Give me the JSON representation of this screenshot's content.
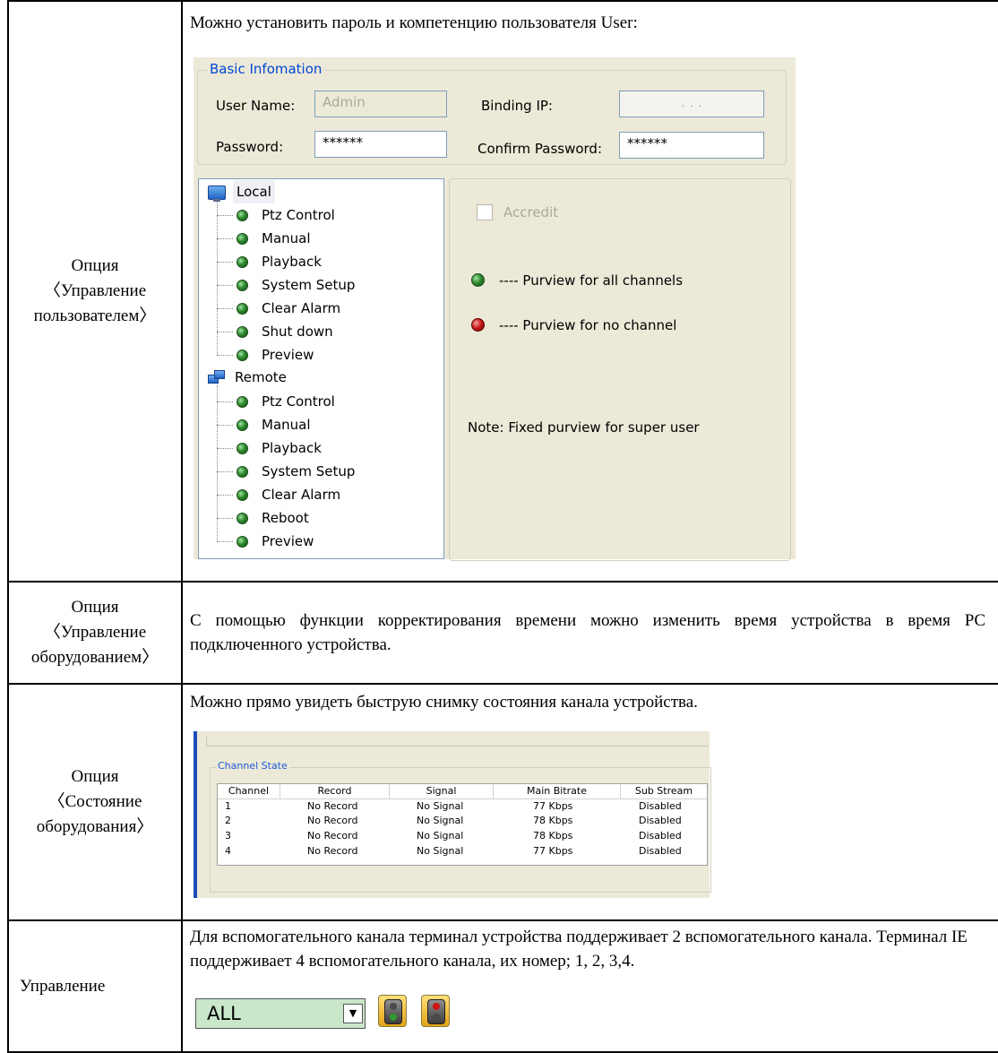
{
  "rows": [
    {
      "left": [
        "Опция",
        "〈Управление",
        "пользователем〉"
      ],
      "right_text": "Можно установить пароль и компетенцию пользователя User:"
    },
    {
      "left": [
        "Опция",
        "〈Управление",
        "оборудованием〉"
      ],
      "right_text": "С помощью функции корректирования времени можно изменить время устройства в время PC подключенного устройства."
    },
    {
      "left": [
        "Опция",
        "〈Состояние",
        "оборудования〉"
      ],
      "right_text": "Можно прямо увидеть быструю снимку состояния канала устройства."
    },
    {
      "left": [
        "Управление"
      ],
      "right_text": "Для вспомогательного канала терминал устройства поддерживает 2 вспомогательного канала. Терминал IE поддерживает 4 вспомогательного канала, их номер; 1, 2, 3,4."
    }
  ],
  "user_dialog": {
    "group_title": "Basic Infomation",
    "user_name_label": "User Name:",
    "user_name_value": "Admin",
    "binding_ip_label": "Binding IP:",
    "binding_ip_value": ".   .   .",
    "password_label": "Password:",
    "password_value": "******",
    "confirm_password_label": "Confirm Password:",
    "confirm_password_value": "******",
    "tree": {
      "local_label": "Local",
      "local_items": [
        "Ptz Control",
        "Manual",
        "Playback",
        "System Setup",
        "Clear Alarm",
        "Shut down",
        "Preview"
      ],
      "remote_label": "Remote",
      "remote_items": [
        "Ptz Control",
        "Manual",
        "Playback",
        "System Setup",
        "Clear Alarm",
        "Reboot",
        "Preview"
      ]
    },
    "accredit_label": "Accredit",
    "legend_all": "----  Purview for all channels",
    "legend_none": "----  Purview for no channel",
    "note": "Note: Fixed purview for super user"
  },
  "channel_state": {
    "group_title": "Channel State",
    "columns": [
      "Channel",
      "Record",
      "Signal",
      "Main Bitrate",
      "Sub Stream"
    ],
    "rows": [
      [
        "1",
        "No Record",
        "No Signal",
        "77 Kbps",
        "Disabled"
      ],
      [
        "2",
        "No Record",
        "No Signal",
        "78 Kbps",
        "Disabled"
      ],
      [
        "3",
        "No Record",
        "No Signal",
        "78 Kbps",
        "Disabled"
      ],
      [
        "4",
        "No Record",
        "No Signal",
        "77 Kbps",
        "Disabled"
      ]
    ]
  },
  "aux_control": {
    "select_value": "ALL",
    "colors": {
      "green": "#2f9a2f",
      "red": "#d01414"
    }
  }
}
